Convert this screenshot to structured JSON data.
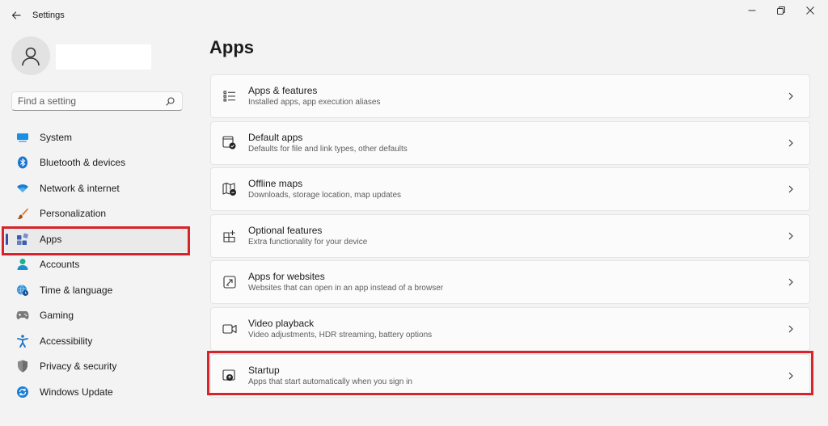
{
  "window": {
    "title": "Settings"
  },
  "search": {
    "placeholder": "Find a setting"
  },
  "sidebar": {
    "items": [
      {
        "label": "System",
        "icon": "monitor-icon"
      },
      {
        "label": "Bluetooth & devices",
        "icon": "bluetooth-icon"
      },
      {
        "label": "Network & internet",
        "icon": "wifi-icon"
      },
      {
        "label": "Personalization",
        "icon": "brush-icon"
      },
      {
        "label": "Apps",
        "icon": "apps-icon",
        "active": true
      },
      {
        "label": "Accounts",
        "icon": "person-icon"
      },
      {
        "label": "Time & language",
        "icon": "globe-clock-icon"
      },
      {
        "label": "Gaming",
        "icon": "gamepad-icon"
      },
      {
        "label": "Accessibility",
        "icon": "accessibility-icon"
      },
      {
        "label": "Privacy & security",
        "icon": "shield-icon"
      },
      {
        "label": "Windows Update",
        "icon": "update-icon"
      }
    ]
  },
  "main": {
    "title": "Apps",
    "cards": [
      {
        "title": "Apps & features",
        "subtitle": "Installed apps, app execution aliases",
        "icon": "list-icon"
      },
      {
        "title": "Default apps",
        "subtitle": "Defaults for file and link types, other defaults",
        "icon": "default-apps-icon"
      },
      {
        "title": "Offline maps",
        "subtitle": "Downloads, storage location, map updates",
        "icon": "map-icon"
      },
      {
        "title": "Optional features",
        "subtitle": "Extra functionality for your device",
        "icon": "grid-plus-icon"
      },
      {
        "title": "Apps for websites",
        "subtitle": "Websites that can open in an app instead of a browser",
        "icon": "link-window-icon"
      },
      {
        "title": "Video playback",
        "subtitle": "Video adjustments, HDR streaming, battery options",
        "icon": "video-icon"
      },
      {
        "title": "Startup",
        "subtitle": "Apps that start automatically when you sign in",
        "icon": "startup-icon"
      }
    ]
  },
  "colors": {
    "accent": "#3c4ba6",
    "highlight": "#d8232a"
  }
}
